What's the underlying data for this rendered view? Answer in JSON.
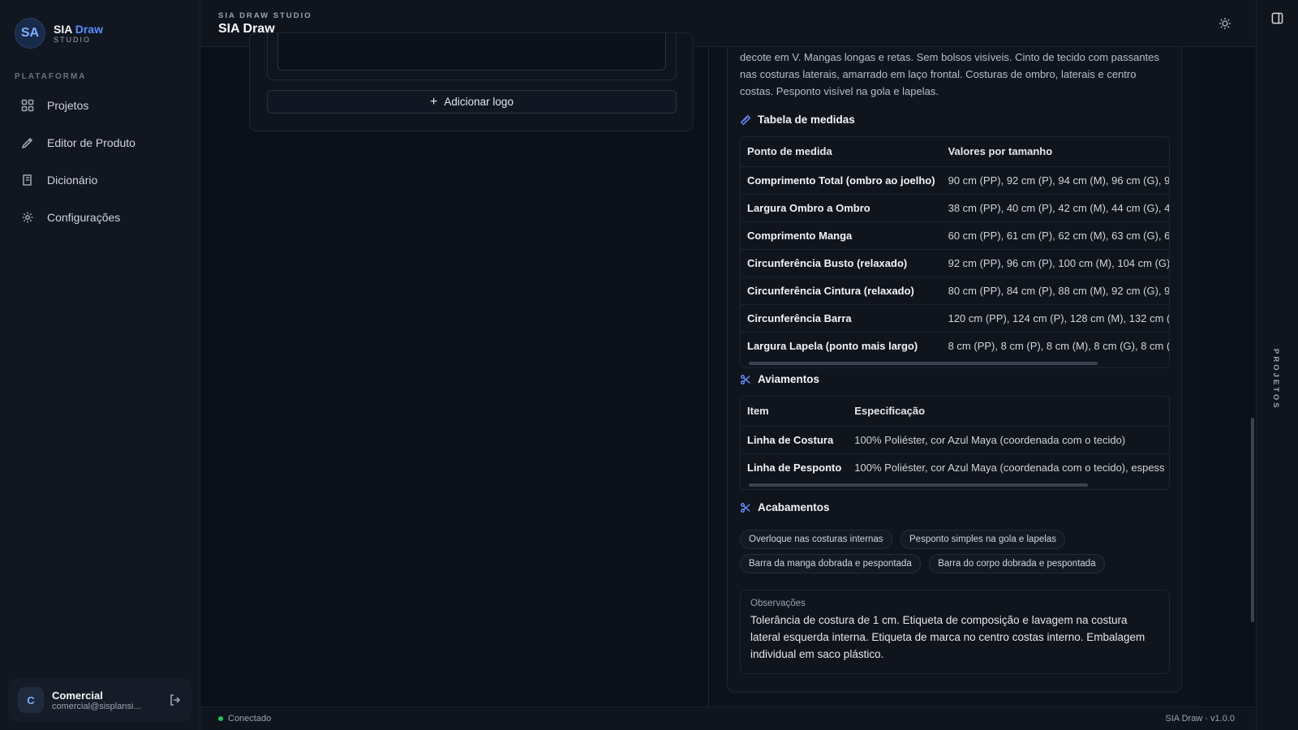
{
  "brand": {
    "logo_text": "SA",
    "name": "SIA",
    "name_accent": "Draw",
    "sub": "STUDIO"
  },
  "sidebar": {
    "section": "PLATAFORMA",
    "items": [
      {
        "label": "Projetos",
        "icon": "grid-icon"
      },
      {
        "label": "Editor de Produto",
        "icon": "pen-tool-icon"
      },
      {
        "label": "Dicionário",
        "icon": "book-icon"
      },
      {
        "label": "Configurações",
        "icon": "gear-icon"
      }
    ]
  },
  "user": {
    "initial": "C",
    "name": "Comercial",
    "email": "comercial@sisplansi..."
  },
  "header": {
    "kicker": "SIA DRAW STUDIO",
    "title": "SIA Draw"
  },
  "rail": {
    "label": "PROJETOS"
  },
  "left": {
    "add_logo_label": "Adicionar logo"
  },
  "detail": {
    "description": "decote em V. Mangas longas e retas. Sem bolsos visíveis. Cinto de tecido com passantes nas costuras laterais, amarrado em laço frontal. Costuras de ombro, laterais e centro costas. Pesponto visível na gola e lapelas.",
    "measures": {
      "title": "Tabela de medidas",
      "headers": [
        "Ponto de medida",
        "Valores por tamanho"
      ],
      "rows": [
        [
          "Comprimento Total (ombro ao joelho)",
          "90 cm (PP), 92 cm (P), 94 cm (M), 96 cm (G), 9"
        ],
        [
          "Largura Ombro a Ombro",
          "38 cm (PP), 40 cm (P), 42 cm (M), 44 cm (G), 4"
        ],
        [
          "Comprimento Manga",
          "60 cm (PP), 61 cm (P), 62 cm (M), 63 cm (G), 6"
        ],
        [
          "Circunferência Busto (relaxado)",
          "92 cm (PP), 96 cm (P), 100 cm (M), 104 cm (G),"
        ],
        [
          "Circunferência Cintura (relaxado)",
          "80 cm (PP), 84 cm (P), 88 cm (M), 92 cm (G), 9"
        ],
        [
          "Circunferência Barra",
          "120 cm (PP), 124 cm (P), 128 cm (M), 132 cm (G"
        ],
        [
          "Largura Lapela (ponto mais largo)",
          "8 cm (PP), 8 cm (P), 8 cm (M), 8 cm (G), 8 cm ("
        ]
      ]
    },
    "trims": {
      "title": "Aviamentos",
      "headers": [
        "Item",
        "Especificação"
      ],
      "rows": [
        [
          "Linha de Costura",
          "100% Poliéster, cor Azul Maya (coordenada com o tecido)"
        ],
        [
          "Linha de Pesponto",
          "100% Poliéster, cor Azul Maya (coordenada com o tecido), espess"
        ]
      ]
    },
    "finishes": {
      "title": "Acabamentos",
      "chips": [
        "Overloque nas costuras internas",
        "Pesponto simples na gola e lapelas",
        "Barra da manga dobrada e pespontada",
        "Barra do corpo dobrada e pespontada"
      ]
    },
    "observations": {
      "label": "Observações",
      "text": "Tolerância de costura de 1 cm. Etiqueta de composição e lavagem na costura lateral esquerda interna. Etiqueta de marca no centro costas interno. Embalagem individual em saco plástico."
    }
  },
  "footer": {
    "status": "Conectado",
    "version": "SIA Draw · v1.0.0"
  },
  "colors": {
    "accent": "#5b8cff",
    "online": "#22c55e",
    "background": "#0b0f17"
  }
}
